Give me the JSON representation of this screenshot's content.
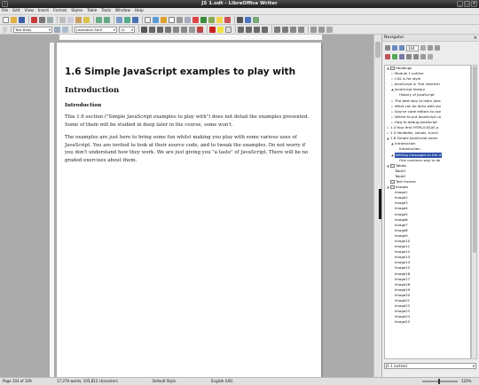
{
  "window": {
    "title": "JS 1.odt - LibreOffice Writer"
  },
  "menu": [
    "File",
    "Edit",
    "View",
    "Insert",
    "Format",
    "Styles",
    "Table",
    "Tools",
    "Window",
    "Help"
  ],
  "formatting": {
    "paragraph_style": "Text Body",
    "font_name": "Liberation Serif",
    "font_size": "12"
  },
  "document": {
    "heading1": "1.6 Simple JavaScript examples to play with",
    "heading2": "Introduction",
    "heading3": "Introduction",
    "para1": "This 1.6 section (\"Simple JavaScript examples to play with\") does not detail the examples presented. Some of them will be studied in deep later in the course, some won't.",
    "para2": "The examples are just here to bring some fun whilst making you play with some various uses of JavaScript. You are invited to look at their source code, and to tweak the examples. Do not worry if you don't understand how they work. We are just giving you \"a taste\" of JavaScript. There will be no graded exercises about them."
  },
  "navigator": {
    "title": "Navigator",
    "page_number": "104",
    "items": [
      {
        "label": "Headings",
        "level": 0,
        "expand": "▲",
        "icon": true
      },
      {
        "label": "Module 1 outline",
        "level": 1,
        "expand": "▷"
      },
      {
        "label": "CSS is for style",
        "level": 1,
        "expand": "▷"
      },
      {
        "label": "JavaScript is \"the interacti",
        "level": 1,
        "expand": "▷"
      },
      {
        "label": "JavaScript history",
        "level": 1,
        "expand": "▲"
      },
      {
        "label": "History of JavaScript",
        "level": 2,
        "expand": ""
      },
      {
        "label": "The best way to learn Java",
        "level": 1,
        "expand": "▷"
      },
      {
        "label": "What can be done with Jav",
        "level": 1,
        "expand": "▷"
      },
      {
        "label": "Source code editors to use",
        "level": 1,
        "expand": "▷"
      },
      {
        "label": "Where to put JavaScript co",
        "level": 1,
        "expand": "▷"
      },
      {
        "label": "How to debug JavaScript",
        "level": 1,
        "expand": "▷"
      },
      {
        "label": "1.4 Your first HTML/CSS/JS p",
        "level": 0,
        "expand": "▷"
      },
      {
        "label": "1.5 Variables, values, functi",
        "level": 0,
        "expand": "▷"
      },
      {
        "label": "1.6 Simple JavaScript exam",
        "level": 0,
        "expand": "▲"
      },
      {
        "label": "Introduction",
        "level": 1,
        "expand": "▲"
      },
      {
        "label": "Introduction",
        "level": 2,
        "expand": ""
      },
      {
        "label": "Writing messages to the d",
        "level": 1,
        "expand": "▲",
        "selected": true
      },
      {
        "label": "One common way to de",
        "level": 2,
        "expand": ""
      },
      {
        "label": "Tables",
        "level": 0,
        "expand": "▲",
        "icon": true
      },
      {
        "label": "Table1",
        "level": 1,
        "expand": ""
      },
      {
        "label": "Table2",
        "level": 1,
        "expand": ""
      },
      {
        "label": "Text frames",
        "level": 0,
        "expand": "",
        "icon": true
      },
      {
        "label": "Images",
        "level": 0,
        "expand": "▲",
        "icon": true
      },
      {
        "label": "Image1",
        "level": 1,
        "expand": ""
      },
      {
        "label": "Image2",
        "level": 1,
        "expand": ""
      },
      {
        "label": "Image3",
        "level": 1,
        "expand": ""
      },
      {
        "label": "Image4",
        "level": 1,
        "expand": ""
      },
      {
        "label": "Image5",
        "level": 1,
        "expand": ""
      },
      {
        "label": "Image6",
        "level": 1,
        "expand": ""
      },
      {
        "label": "Image7",
        "level": 1,
        "expand": ""
      },
      {
        "label": "Image8",
        "level": 1,
        "expand": ""
      },
      {
        "label": "Image9",
        "level": 1,
        "expand": ""
      },
      {
        "label": "Image10",
        "level": 1,
        "expand": ""
      },
      {
        "label": "Image11",
        "level": 1,
        "expand": ""
      },
      {
        "label": "Image12",
        "level": 1,
        "expand": ""
      },
      {
        "label": "Image13",
        "level": 1,
        "expand": ""
      },
      {
        "label": "Image14",
        "level": 1,
        "expand": ""
      },
      {
        "label": "Image15",
        "level": 1,
        "expand": ""
      },
      {
        "label": "Image16",
        "level": 1,
        "expand": ""
      },
      {
        "label": "Image17",
        "level": 1,
        "expand": ""
      },
      {
        "label": "Image18",
        "level": 1,
        "expand": ""
      },
      {
        "label": "Image19",
        "level": 1,
        "expand": ""
      },
      {
        "label": "Image20",
        "level": 1,
        "expand": ""
      },
      {
        "label": "Image21",
        "level": 1,
        "expand": ""
      },
      {
        "label": "Image22",
        "level": 1,
        "expand": ""
      },
      {
        "label": "Image23",
        "level": 1,
        "expand": ""
      },
      {
        "label": "Image24",
        "level": 1,
        "expand": ""
      },
      {
        "label": "Image25",
        "level": 1,
        "expand": ""
      }
    ],
    "document_select": "JS 1 (active)"
  },
  "status": {
    "page": "Page 103 of 109",
    "words": "17,279 words, 105,812 characters",
    "style": "Default Style",
    "language": "English (UK)",
    "zoom": "120%"
  },
  "colors": {
    "selection": "#2b4fa8",
    "titlebar": "#2a2a2a"
  }
}
